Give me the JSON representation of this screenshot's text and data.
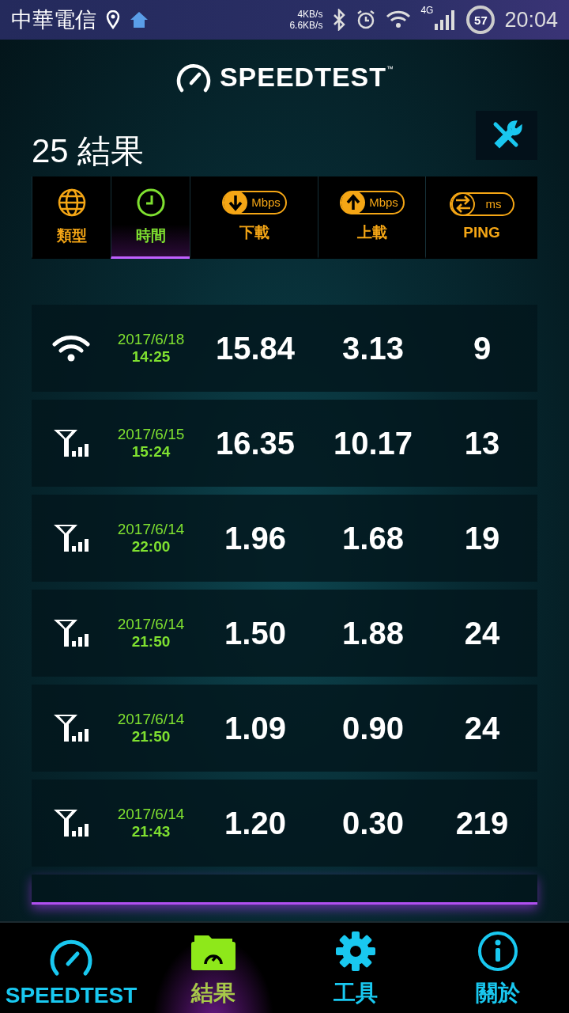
{
  "status_bar": {
    "carrier": "中華電信",
    "speeds": [
      "4KB/s",
      "6.6KB/s"
    ],
    "network": "4G",
    "battery": "57",
    "time": "20:04"
  },
  "header": {
    "logo": "SPEEDTEST",
    "trademark": "™"
  },
  "title": "25 結果",
  "sort_tabs": [
    {
      "kind": "type",
      "label": "類型",
      "selected": false
    },
    {
      "kind": "time",
      "label": "時間",
      "selected": true
    },
    {
      "kind": "download",
      "label": "下載",
      "unit": "Mbps",
      "selected": false
    },
    {
      "kind": "upload",
      "label": "上載",
      "unit": "Mbps",
      "selected": false
    },
    {
      "kind": "ping",
      "label": "PING",
      "unit": "ms",
      "selected": false
    }
  ],
  "results": [
    {
      "kind": "wifi",
      "date": "2017/6/18",
      "time": "14:25",
      "download": "15.84",
      "upload": "3.13",
      "ping": "9"
    },
    {
      "kind": "cellular",
      "date": "2017/6/15",
      "time": "15:24",
      "download": "16.35",
      "upload": "10.17",
      "ping": "13"
    },
    {
      "kind": "cellular",
      "date": "2017/6/14",
      "time": "22:00",
      "download": "1.96",
      "upload": "1.68",
      "ping": "19"
    },
    {
      "kind": "cellular",
      "date": "2017/6/14",
      "time": "21:50",
      "download": "1.50",
      "upload": "1.88",
      "ping": "24"
    },
    {
      "kind": "cellular",
      "date": "2017/6/14",
      "time": "21:50",
      "download": "1.09",
      "upload": "0.90",
      "ping": "24"
    },
    {
      "kind": "cellular",
      "date": "2017/6/14",
      "time": "21:43",
      "download": "1.20",
      "upload": "0.30",
      "ping": "219"
    }
  ],
  "nav": [
    {
      "kind": "speedtest",
      "label": "SPEEDTEST",
      "selected": false
    },
    {
      "kind": "results",
      "label": "結果",
      "selected": true
    },
    {
      "kind": "tools",
      "label": "工具",
      "selected": false
    },
    {
      "kind": "about",
      "label": "關於",
      "selected": false
    }
  ]
}
